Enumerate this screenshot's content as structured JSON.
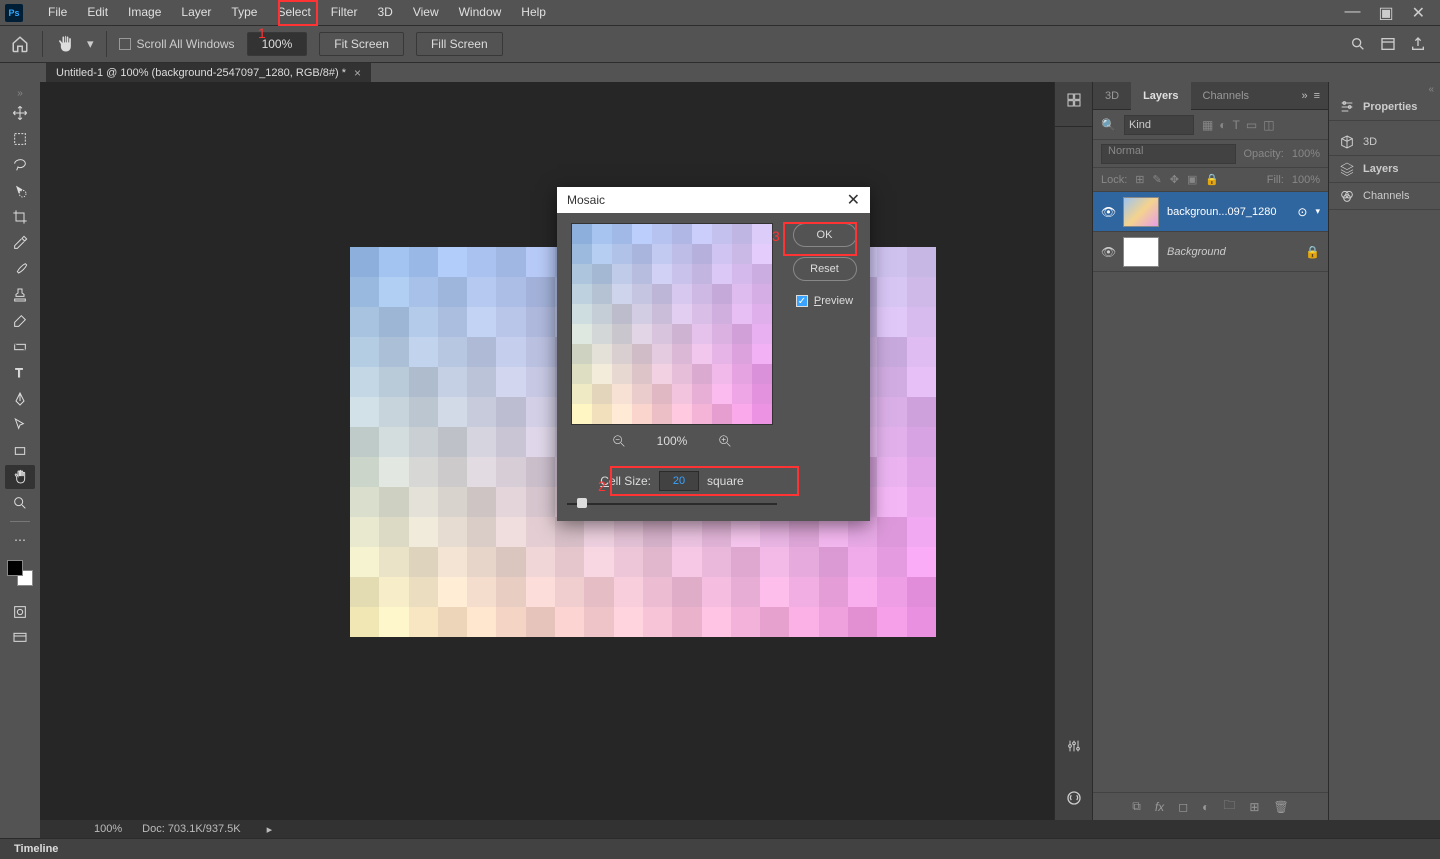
{
  "menubar": {
    "items": [
      "File",
      "Edit",
      "Image",
      "Layer",
      "Type",
      "Select",
      "Filter",
      "3D",
      "View",
      "Window",
      "Help"
    ]
  },
  "optbar": {
    "scroll_all": "Scroll All Windows",
    "zoom_btn": "100%",
    "fit_screen": "Fit Screen",
    "fill_screen": "Fill Screen"
  },
  "tab": {
    "title": "Untitled-1 @ 100% (background-2547097_1280, RGB/8#) *"
  },
  "panels": {
    "tab_3d": "3D",
    "tab_layers": "Layers",
    "tab_channels": "Channels",
    "kind": "Kind",
    "blend": "Normal",
    "opacity_label": "Opacity:",
    "opacity_val": "100%",
    "lock_label": "Lock:",
    "fill_label": "Fill:",
    "fill_val": "100%",
    "layer1": "backgroun...097_1280",
    "layer2": "Background"
  },
  "farright": {
    "properties": "Properties",
    "d3": "3D",
    "layers": "Layers",
    "channels": "Channels"
  },
  "dialog": {
    "title": "Mosaic",
    "ok": "OK",
    "reset": "Reset",
    "preview": "Preview",
    "zoom": "100%",
    "cell_label": "Cell Size:",
    "cell_value": "20",
    "cell_unit": "square"
  },
  "status": {
    "zoom": "100%",
    "doc": "Doc: 703.1K/937.5K"
  },
  "timeline": {
    "label": "Timeline"
  },
  "annotations": {
    "n1": "1",
    "n2": "2",
    "n3": "3"
  }
}
